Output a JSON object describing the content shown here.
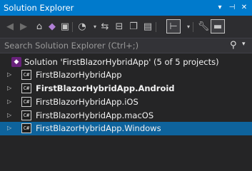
{
  "window": {
    "title": "Solution Explorer",
    "controls": [
      "chevron-down-icon",
      "pin-icon",
      "close-icon"
    ]
  },
  "toolbar": {
    "buttons": [
      "back-icon",
      "forward-icon",
      "home-icon",
      "vs-icon",
      "switch-views-icon",
      "history-icon",
      "sync-icon",
      "collapse-icon",
      "show-all-files-icon",
      "properties-icon",
      "preview-icon",
      "settings-icon",
      "minus-icon"
    ]
  },
  "search": {
    "placeholder": "Search Solution Explorer (Ctrl+;)"
  },
  "tree": {
    "solution": "Solution 'FirstBlazorHybridApp' (5 of 5 projects)",
    "projects": [
      {
        "label": "FirstBlazorHybridApp",
        "bold": false,
        "selected": false
      },
      {
        "label": "FirstBlazorHybridApp.Android",
        "bold": true,
        "selected": false
      },
      {
        "label": "FirstBlazorHybridApp.iOS",
        "bold": false,
        "selected": false
      },
      {
        "label": "FirstBlazorHybridApp.macOS",
        "bold": false,
        "selected": false
      },
      {
        "label": "FirstBlazorHybridApp.Windows",
        "bold": false,
        "selected": true
      }
    ],
    "project_icon_text": "C#"
  },
  "colors": {
    "accent": "#007acc",
    "selection": "#0e639c",
    "background": "#252526"
  }
}
